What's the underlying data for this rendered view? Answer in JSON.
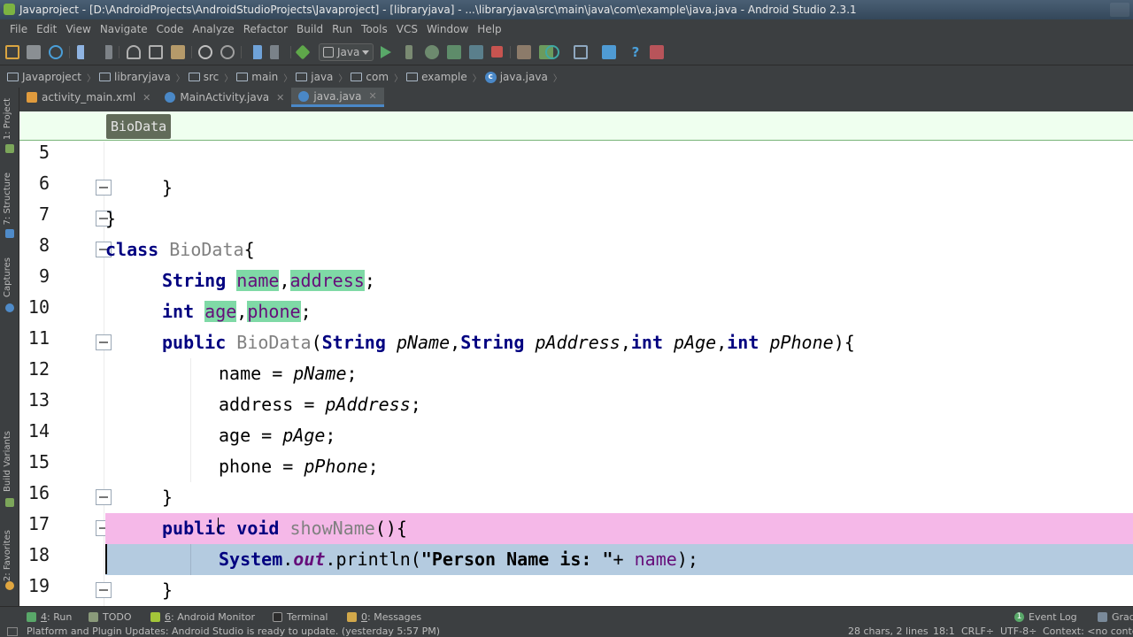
{
  "window": {
    "title": "Javaproject - [D:\\AndroidProjects\\AndroidStudioProjects\\Javaproject] - [libraryjava] - ...\\libraryjava\\src\\main\\java\\com\\example\\java.java - Android Studio 2.3.1"
  },
  "menu": [
    "File",
    "Edit",
    "View",
    "Navigate",
    "Code",
    "Analyze",
    "Refactor",
    "Build",
    "Run",
    "Tools",
    "VCS",
    "Window",
    "Help"
  ],
  "toolbar": {
    "run_config": "Java",
    "icons": [
      "open-folder-icon",
      "save-icon",
      "sync-icon",
      "undo-icon",
      "redo-icon",
      "cut-icon",
      "copy-icon",
      "paste-icon",
      "find-icon",
      "replace-icon",
      "back-icon",
      "forward-icon",
      "make-icon",
      "run-icon",
      "apply-changes-icon",
      "debug-icon",
      "attach-debugger-icon",
      "stop-icon",
      "avd-manager-icon",
      "sdk-manager-icon",
      "sync-gradle-icon",
      "project-structure-icon",
      "android-device-monitor-icon",
      "help-icon",
      "android-monitor-icon"
    ]
  },
  "breadcrumb": [
    {
      "label": "Javaproject",
      "icon": "folder-icon"
    },
    {
      "label": "libraryjava",
      "icon": "folder-icon"
    },
    {
      "label": "src",
      "icon": "folder-icon"
    },
    {
      "label": "main",
      "icon": "folder-icon"
    },
    {
      "label": "java",
      "icon": "folder-icon"
    },
    {
      "label": "com",
      "icon": "folder-icon"
    },
    {
      "label": "example",
      "icon": "folder-icon"
    },
    {
      "label": "java.java",
      "icon": "class-icon"
    }
  ],
  "left_strip": {
    "project": "1: Project",
    "structure": "7: Structure",
    "captures": "Captures",
    "build_variants": "Build Variants",
    "favorites": "2: Favorites"
  },
  "tabs": [
    {
      "label": "activity_main.xml",
      "icon": "xml-file-icon",
      "active": false
    },
    {
      "label": "MainActivity.java",
      "icon": "class-icon",
      "active": false
    },
    {
      "label": "java.java",
      "icon": "class-icon",
      "active": true
    }
  ],
  "editor": {
    "sticky_class": "BioData",
    "line_numbers": [
      "5",
      "6",
      "7",
      "8",
      "9",
      "10",
      "11",
      "12",
      "13",
      "14",
      "15",
      "16",
      "17",
      "18",
      "19"
    ],
    "code": {
      "l6": "}",
      "l7": "}",
      "l8_kw": "class",
      "l8_name": "BioData",
      "l8_rest": "{",
      "l9_type": "String",
      "l9_f1": "name",
      "l9_comma": ",",
      "l9_f2": "address",
      "l9_end": ";",
      "l10_type": "int",
      "l10_f1": "age",
      "l10_comma": ",",
      "l10_f2": "phone",
      "l10_end": ";",
      "l11_kw": "public",
      "l11_name": "BioData",
      "l11_p0": "(",
      "l11_t1": "String",
      "l11_a1": "pName",
      "l11_c1": ",",
      "l11_t2": "String",
      "l11_a2": "pAddress",
      "l11_c2": ",",
      "l11_t3": "int",
      "l11_a3": "pAge",
      "l11_c3": ",",
      "l11_t4": "int",
      "l11_a4": "pPhone",
      "l11_end": "){",
      "l12_lhs": "name = ",
      "l12_rhs": "pName",
      "l12_end": ";",
      "l13_lhs": "address = ",
      "l13_rhs": "pAddress",
      "l13_end": ";",
      "l14_lhs": "age = ",
      "l14_rhs": "pAge",
      "l14_end": ";",
      "l15_lhs": "phone = ",
      "l15_rhs": "pPhone",
      "l15_end": ";",
      "l16": "}",
      "l17_kw1": "public",
      "l17_kw2": "void",
      "l17_name": "showName",
      "l17_end": "(){",
      "l18_cls": "System",
      "l18_dot": ".",
      "l18_out": "out",
      "l18_call": ".println(",
      "l18_str": "\"Person Name is: \"",
      "l18_plus": "+ ",
      "l18_var": "name",
      "l18_end": ");",
      "l19": "}"
    }
  },
  "bottom_tabs": [
    {
      "num": "4",
      "label": ": Run",
      "icon": "run-icon"
    },
    {
      "num": "",
      "label": "TODO",
      "icon": "todo-icon"
    },
    {
      "num": "6",
      "label": ": Android Monitor",
      "icon": "android-icon"
    },
    {
      "num": "",
      "label": "Terminal",
      "icon": "terminal-icon"
    },
    {
      "num": "0",
      "label": ": Messages",
      "icon": "messages-icon"
    }
  ],
  "right_bottom_tabs": [
    {
      "label": "Event Log",
      "badge": "1"
    },
    {
      "label": "Grad"
    }
  ],
  "status": {
    "message": "Platform and Plugin Updates: Android Studio is ready to update. (yesterday 5:57 PM)",
    "selection": "28 chars, 2 lines",
    "position": "18:1",
    "line_sep": "CRLF÷",
    "encoding": "UTF-8÷",
    "context": "Context: <no conte"
  },
  "colors": {
    "ide_bg": "#3c3f41",
    "editor_bg": "#ffffff",
    "keyword": "#000080",
    "field_highlight": "#7fd9a6",
    "breakpoint_line": "#f5b8e8",
    "caret_line": "#b4cbe0"
  }
}
